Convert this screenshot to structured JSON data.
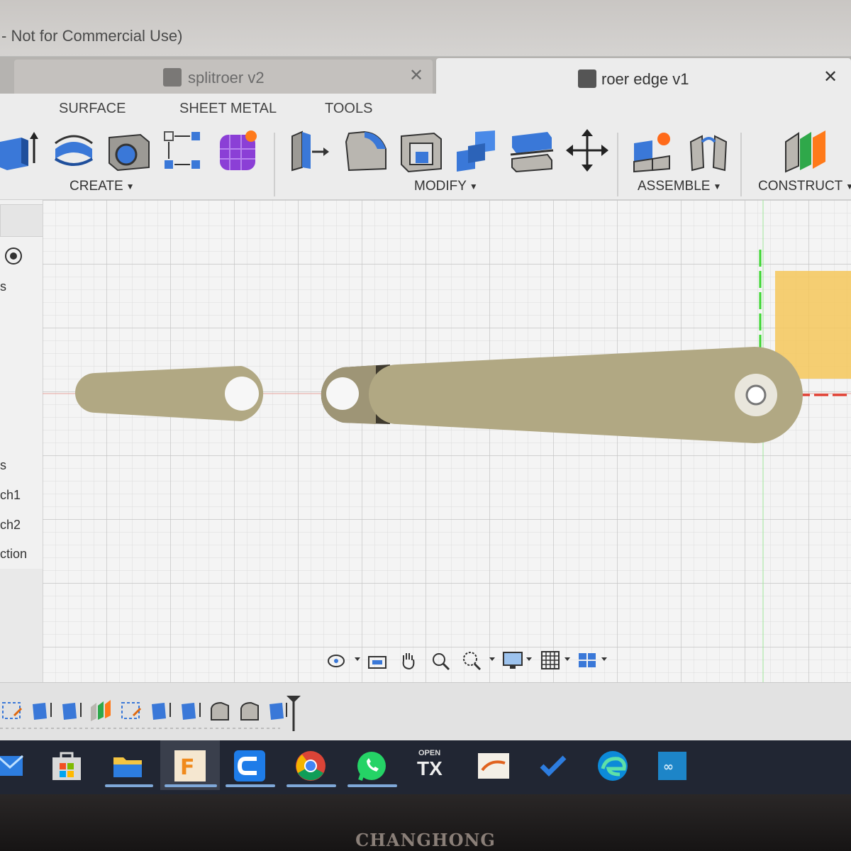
{
  "window": {
    "title": "- Not for Commercial Use)"
  },
  "tabs": [
    {
      "label": "splitroer v2",
      "close": "✕",
      "active": false
    },
    {
      "label": "roer edge v1",
      "close": "✕",
      "active": true
    }
  ],
  "ribbon": {
    "tabs": [
      "SURFACE",
      "SHEET METAL",
      "TOOLS"
    ],
    "groups": {
      "create": "CREATE",
      "modify": "MODIFY",
      "assemble": "ASSEMBLE",
      "construct": "CONSTRUCT"
    },
    "caret": "▼",
    "create_icons": [
      "extrude-icon",
      "revolve-icon",
      "hole-icon",
      "pattern-icon",
      "create-form-icon"
    ],
    "modify_icons": [
      "press-pull-icon",
      "fillet-icon",
      "shell-icon",
      "combine-icon",
      "split-body-icon",
      "move-icon"
    ],
    "assemble_icons": [
      "new-component-icon",
      "joint-icon"
    ],
    "construct_icons": [
      "offset-plane-icon"
    ]
  },
  "browser": {
    "items": [
      "s",
      "s",
      "ch1",
      "ch2",
      "ction"
    ],
    "head_icon": "eye-icon"
  },
  "colors": {
    "part_fill": "#b1a883",
    "part_shadow": "#3f3a2e",
    "grid_major": "#c8c8c8",
    "grid_minor": "#dcdcdc",
    "axis_red": "#e0382b",
    "axis_green": "#3bd630",
    "plane_yellow": "#f5c75a",
    "taskbar": "#212633"
  },
  "navbar": {
    "icons": [
      "orbit-icon",
      "look-at-icon",
      "pan-icon",
      "zoom-icon",
      "zoom-window-icon",
      "display-settings-icon",
      "grid-settings-icon",
      "viewports-icon"
    ]
  },
  "timeline": {
    "items": [
      "sketch",
      "extrude",
      "extrude",
      "plane",
      "sketch",
      "extrude",
      "extrude",
      "fillet",
      "fillet",
      "extrude"
    ]
  },
  "taskbar": {
    "apps": [
      "mail-icon",
      "store-icon",
      "file-explorer-icon",
      "fusion360-icon",
      "ccleaner-icon",
      "chrome-icon",
      "whatsapp-icon",
      "opentx-icon",
      "app-icon",
      "todo-icon",
      "edge-icon",
      "arduino-icon"
    ],
    "opentx_label": [
      "OPEN",
      "TX"
    ]
  },
  "monitor": {
    "brand": "CHANGHONG"
  }
}
